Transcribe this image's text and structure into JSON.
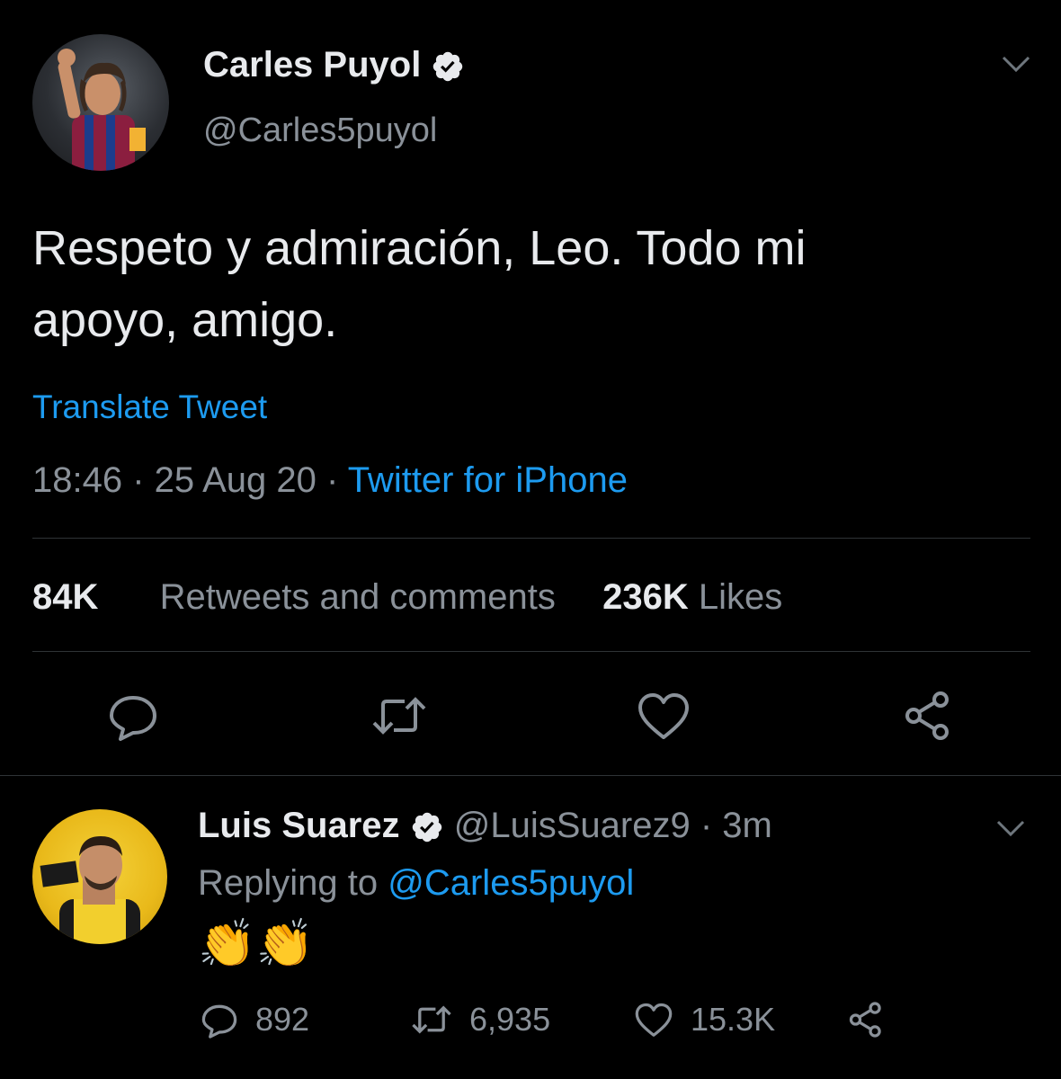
{
  "main_tweet": {
    "author_name": "Carles Puyol",
    "author_handle": "@Carles5puyol",
    "verified": true,
    "text_line1": "Respeto y admiración, Leo. Todo mi",
    "text_line2": "apoyo, amigo.",
    "translate_label": "Translate Tweet",
    "time": "18:46",
    "date": "25 Aug 20",
    "source": "Twitter for iPhone",
    "retweets_count": "84K",
    "retweets_label": "Retweets and comments",
    "likes_count": "236K",
    "likes_label": "Likes",
    "actions": [
      "reply-icon",
      "retweet-icon",
      "like-icon",
      "share-icon"
    ]
  },
  "reply_tweet": {
    "author_name": "Luis Suarez",
    "author_handle": "@LuisSuarez9",
    "time_ago": "3m",
    "verified": true,
    "replying_to_label": "Replying to",
    "replying_to_handle": "@Carles5puyol",
    "text": "👏👏",
    "reply_count": "892",
    "retweet_count": "6,935",
    "like_count": "15.3K"
  },
  "colors": {
    "background": "#000000",
    "link": "#1d9bf0",
    "secondary_text": "#8a9199",
    "divider": "#2f3336"
  }
}
